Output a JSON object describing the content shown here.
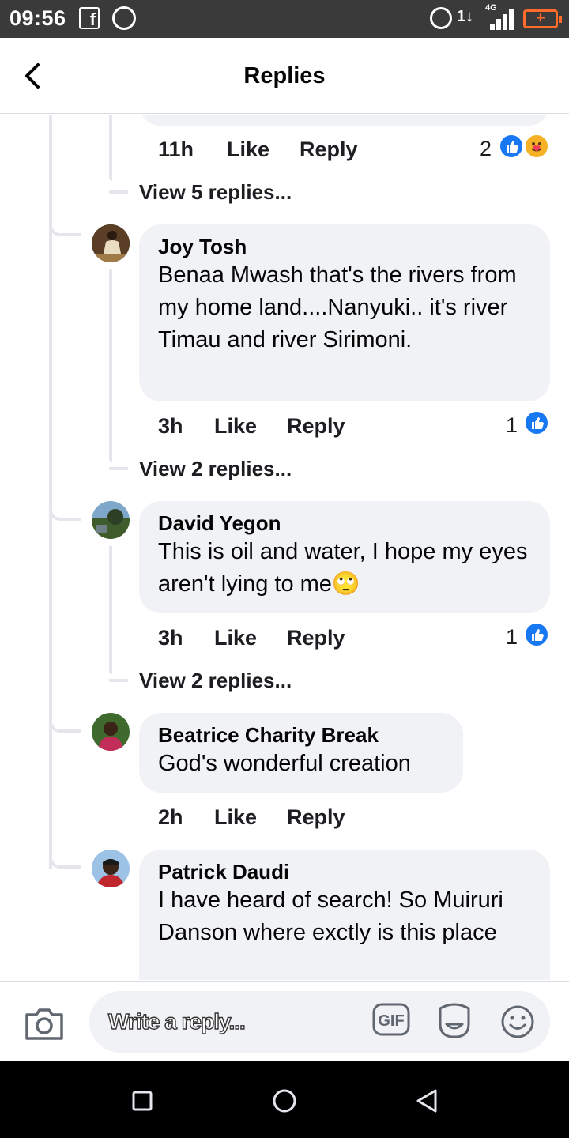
{
  "status_bar": {
    "time": "09:56",
    "network": "1↓",
    "network_type": "4G",
    "battery": "+"
  },
  "header": {
    "title": "Replies"
  },
  "thread": {
    "top_item": {
      "time": "11h",
      "like_label": "Like",
      "reply_label": "Reply",
      "reaction_count": "2",
      "reactions": [
        "like-icon",
        "care-icon"
      ],
      "view_replies": "View 5 replies..."
    },
    "comments": [
      {
        "author": "Joy Tosh",
        "text": "Benaa Mwash that's the rivers from my home land....Nanyuki.. it's river Timau and  river Sirimoni.",
        "time": "3h",
        "like_label": "Like",
        "reply_label": "Reply",
        "reaction_count": "1",
        "view_replies": "View 2 replies..."
      },
      {
        "author": "David Yegon",
        "text": "This is oil and water, I hope my eyes aren't lying to me🙄",
        "time": "3h",
        "like_label": "Like",
        "reply_label": "Reply",
        "reaction_count": "1",
        "view_replies": "View 2 replies..."
      },
      {
        "author": "Beatrice Charity Break",
        "text": "God's wonderful creation",
        "time": "2h",
        "like_label": "Like",
        "reply_label": "Reply"
      },
      {
        "author": "Patrick Daudi",
        "text": "I have heard of search! So Muiruri Danson  where exctly is this place"
      }
    ]
  },
  "composer": {
    "placeholder": "Write a reply...",
    "gif_label": "GIF"
  },
  "colors": {
    "accent": "#1877f2",
    "bubble": "#f0f2f5",
    "thread_line": "#e4e6eb"
  }
}
